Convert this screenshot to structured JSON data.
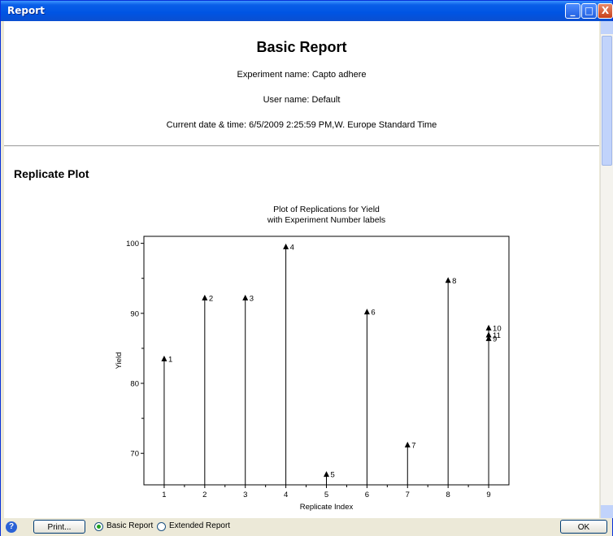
{
  "window": {
    "title": "Report",
    "min_glyph": "_",
    "max_glyph": "□",
    "close_glyph": "X"
  },
  "report": {
    "title": "Basic Report",
    "experiment": "Experiment name: Capto adhere",
    "user": "User name: Default",
    "datetime": "Current date & time: 6/5/2009 2:25:59 PM,W. Europe Standard Time",
    "section": "Replicate Plot"
  },
  "chart_data": {
    "type": "scatter",
    "title": "Plot of Replications for Yield",
    "subtitle": "with Experiment Number labels",
    "xlabel": "Replicate Index",
    "ylabel": "Yield",
    "xlim": [
      0.5,
      9.5
    ],
    "ylim": [
      65.5,
      101
    ],
    "xticks": [
      1,
      2,
      3,
      4,
      5,
      6,
      7,
      8,
      9
    ],
    "yticks": [
      70,
      80,
      90,
      100
    ],
    "marker": "triangle",
    "points": [
      {
        "x": 1,
        "y": 83.5,
        "label": "1"
      },
      {
        "x": 2,
        "y": 92.2,
        "label": "2"
      },
      {
        "x": 3,
        "y": 92.2,
        "label": "3"
      },
      {
        "x": 4,
        "y": 99.5,
        "label": "4"
      },
      {
        "x": 5,
        "y": 67.0,
        "label": "5"
      },
      {
        "x": 6,
        "y": 90.2,
        "label": "6"
      },
      {
        "x": 7,
        "y": 71.2,
        "label": "7"
      },
      {
        "x": 8,
        "y": 94.7,
        "label": "8"
      },
      {
        "x": 9,
        "y": 86.4,
        "label": "9"
      },
      {
        "x": 9,
        "y": 87.9,
        "label": "10"
      },
      {
        "x": 9,
        "y": 86.9,
        "label": "11"
      }
    ]
  },
  "footer": {
    "print_label": "Print...",
    "basic_label": "Basic Report",
    "extended_label": "Extended Report",
    "ok_label": "OK",
    "help_glyph": "?",
    "selected": "basic"
  }
}
